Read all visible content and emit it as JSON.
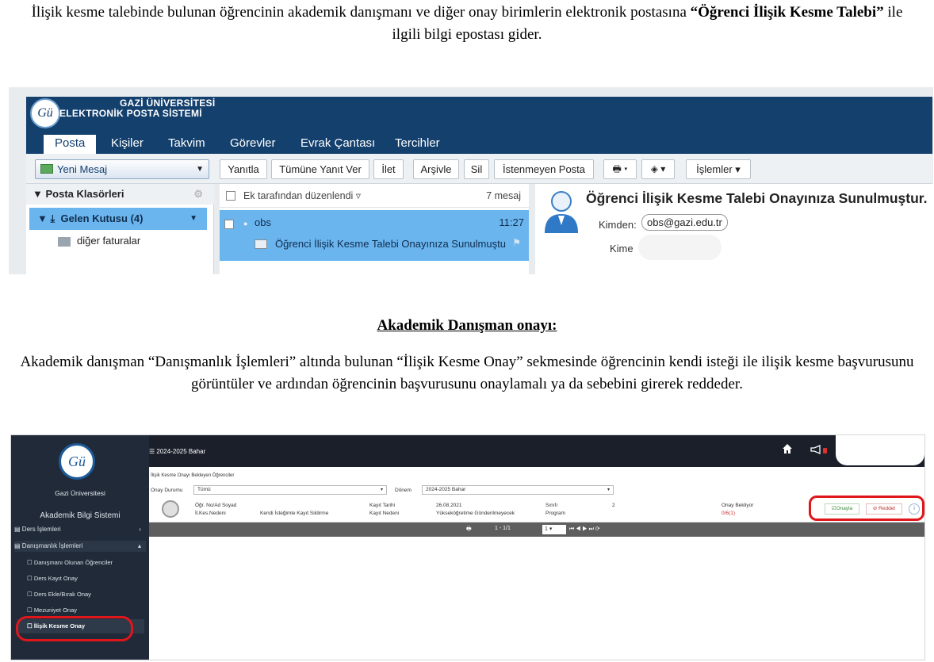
{
  "doc": {
    "para1_pre": "İlişik kesme talebinde bulunan öğrencinin akademik danışmanı ve diğer onay birimlerin elektronik postasına ",
    "para1_bold": "“Öğrenci İlişik Kesme Talebi”",
    "para1_post": " ile ilgili bilgi epostası gider.",
    "heading": "Akademik Danışman onayı:",
    "para2": "Akademik danışman “Danışmanlık İşlemleri” altında bulunan “İlişik Kesme Onay” sekmesinde öğrencinin kendi isteği ile ilişik kesme başvurusunu görüntüler ve ardından öğrencinin başvurusunu onaylamalı ya da sebebini girerek reddeder."
  },
  "mail": {
    "org_line1": "GAZİ ÜNİVERSİTESİ",
    "org_line2": "ELEKTRONİK POSTA SİSTEMİ",
    "tabs": [
      "Posta",
      "Kişiler",
      "Takvim",
      "Görevler",
      "Evrak Çantası",
      "Tercihler"
    ],
    "new_message": "Yeni Mesaj",
    "toolbar": [
      "Yanıtla",
      "Tümüne Yanıt Ver",
      "İlet",
      "Arşivle",
      "Sil",
      "İstenmeyen Posta"
    ],
    "actions_menu": "İşlemler",
    "folders_title": "Posta Klasörleri",
    "inbox": "Gelen Kutusu (4)",
    "folder_other": "diğer faturalar",
    "sort_label": "Ek tarafından düzenlendi",
    "message_count": "7 mesaj",
    "message": {
      "sender": "obs",
      "time": "11:27",
      "subject": "Öğrenci İlişik Kesme Talebi Onayınıza Sunulmuştu"
    },
    "reader": {
      "subject": "Öğrenci İlişik Kesme Talebi Onayınıza Sunulmuştur.",
      "from_label": "Kimden:",
      "from": "obs@gazi.edu.tr",
      "to_label": "Kime"
    },
    "colors": {
      "banner": "#14406e",
      "selection": "#6bb5ef"
    }
  },
  "obs": {
    "university": "Gazi Üniversitesi",
    "system": "Akademik Bilgi Sistemi",
    "term": "2024-2025 Bahar",
    "menu": {
      "ders_islemleri": "Ders İşlemleri",
      "danismanlik": "Danışmanlık İşlemleri",
      "sub": [
        "Danışmanı Olunan Öğrenciler",
        "Ders Kayıt Onay",
        "Ders Ekle/Bırak Onay",
        "Mezuniyet Onay",
        "İlişik Kesme Onay"
      ]
    },
    "breadcrumb": "İlişik Kesme Onayı Bekleyen Öğrenciler",
    "filter": {
      "status_label": "Onay Durumu",
      "status_value": "Tümü",
      "term_label": "Dönem",
      "term_value": "2024-2025 Bahar"
    },
    "row": {
      "name_label": "Öğr. No/Ad Soyad",
      "reason_label": "İl.Kes.Nedeni",
      "reason_value": "Kendi İsteğimle Kayıt Sildirme",
      "date_label": "Kayıt Tarihi",
      "date_value": "26.08.2021",
      "cause_label": "Kayıt Nedeni",
      "cause_value": "Yükseköğretime Gönderilmeyecek",
      "class_label": "Sınıfı",
      "class_value": "2",
      "program_label": "Program",
      "status_value": "Onay Bekliyor",
      "status_code": "0/6(1)"
    },
    "buttons": {
      "approve": "Onayla",
      "reject": "Reddet",
      "info": "i"
    },
    "pager": {
      "range": "1 - 1/1",
      "page_size": "1"
    },
    "colors": {
      "sidebar": "#202a38",
      "highlight_ring": "#e0161b",
      "approve": "#3a8a3a",
      "reject": "#c03030"
    }
  }
}
